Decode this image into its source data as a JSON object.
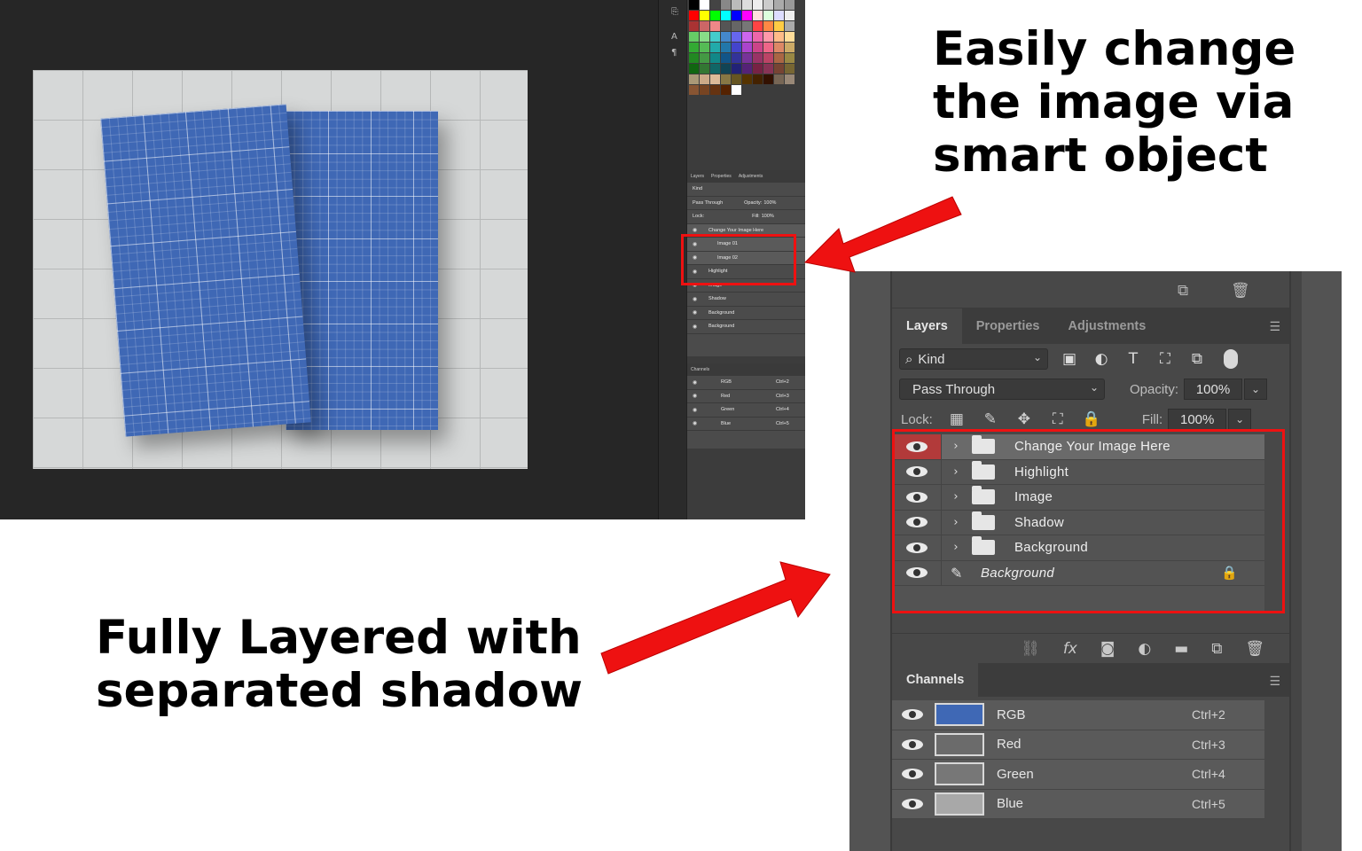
{
  "annotations": {
    "top_lines": [
      "Easily change",
      "the image via",
      "smart object"
    ],
    "bottom_lines": [
      "Fully Layered with",
      "separated shadow"
    ]
  },
  "colors": {
    "arrow_red": "#ee1111",
    "panel_bg": "#484848",
    "selected_row": "#6a6a6a",
    "selected_eye": "#b23a3a",
    "book_blue": "#3f68b5"
  },
  "mini_panel": {
    "tabs": [
      "Layers",
      "Properties",
      "Adjustments"
    ],
    "kind": "Kind",
    "blend_mode": "Pass Through",
    "opacity_label": "Opacity:",
    "opacity": "100%",
    "lock_label": "Lock:",
    "fill_label": "Fill:",
    "fill": "100%",
    "layers": [
      {
        "name": "Change Your Image Here",
        "indent": 0
      },
      {
        "name": "Image 01",
        "indent": 1
      },
      {
        "name": "Image 02",
        "indent": 1
      },
      {
        "name": "Highlight",
        "indent": 0
      },
      {
        "name": "Image",
        "indent": 0
      },
      {
        "name": "Shadow",
        "indent": 0
      },
      {
        "name": "Background",
        "indent": 0
      },
      {
        "name": "Background",
        "indent": 0
      }
    ],
    "channels_title": "Channels",
    "channels": [
      {
        "name": "RGB",
        "shortcut": "Ctrl+2"
      },
      {
        "name": "Red",
        "shortcut": "Ctrl+3"
      },
      {
        "name": "Green",
        "shortcut": "Ctrl+4"
      },
      {
        "name": "Blue",
        "shortcut": "Ctrl+5"
      }
    ]
  },
  "panel": {
    "tabs": {
      "layers": "Layers",
      "properties": "Properties",
      "adjustments": "Adjustments"
    },
    "filter": {
      "kind": "Kind"
    },
    "blend": {
      "mode": "Pass Through",
      "opacity_label": "Opacity:",
      "opacity": "100%"
    },
    "lock": {
      "label": "Lock:",
      "fill_label": "Fill:",
      "fill": "100%"
    },
    "layers": [
      {
        "name": "Change Your Image Here"
      },
      {
        "name": "Highlight"
      },
      {
        "name": "Image"
      },
      {
        "name": "Shadow"
      },
      {
        "name": "Background"
      },
      {
        "name": "Background"
      }
    ],
    "channels": {
      "title": "Channels",
      "rows": [
        {
          "name": "RGB",
          "shortcut": "Ctrl+2"
        },
        {
          "name": "Red",
          "shortcut": "Ctrl+3"
        },
        {
          "name": "Green",
          "shortcut": "Ctrl+4"
        },
        {
          "name": "Blue",
          "shortcut": "Ctrl+5"
        }
      ]
    }
  }
}
